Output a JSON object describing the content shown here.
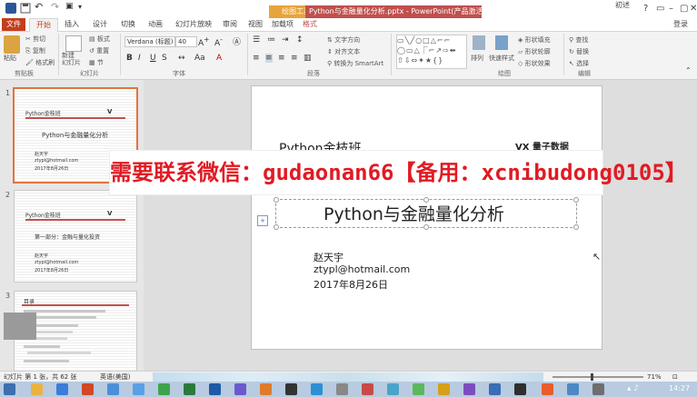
{
  "window": {
    "doc_title": "Python与金融量化分析.pptx - PowerPoint(产品激活失败)",
    "context_tool": "绘图工具",
    "user_label": "登录",
    "top_right_text": "初述"
  },
  "tabs": [
    "文件",
    "开始",
    "插入",
    "设计",
    "切换",
    "动画",
    "幻灯片放映",
    "审阅",
    "视图",
    "加载项",
    "格式"
  ],
  "ribbon": {
    "clipboard": {
      "paste": "粘贴",
      "cut": "剪切",
      "copy": "复制",
      "painter": "格式刷",
      "group": "剪贴板"
    },
    "slides": {
      "new": "新建\n幻灯片",
      "layout": "板式",
      "reset": "重置",
      "section": "节",
      "group": "幻灯片"
    },
    "font": {
      "name": "Verdana (标题)",
      "size": "40",
      "bold": "B",
      "italic": "I",
      "underline": "U",
      "strike": "S",
      "group": "字体"
    },
    "paragraph": {
      "direction": "文字方向",
      "align": "对齐文本",
      "smartart": "转换为 SmartArt",
      "group": "段落"
    },
    "drawing": {
      "arrange": "排列",
      "quick_styles": "快速样式",
      "fill": "形状填充",
      "outline": "形状轮廓",
      "effects": "形状效果",
      "group": "绘图"
    },
    "editing": {
      "find": "查找",
      "replace": "替换",
      "select": "选择",
      "group": "编辑"
    }
  },
  "thumbnails": [
    {
      "number": "1",
      "header": "Python金枝班",
      "title": "Python与金融量化分析",
      "author": "赵天宇",
      "email": "ztypl@hotmail.com",
      "date": "2017年8月26日"
    },
    {
      "number": "2",
      "header": "Python金枝班",
      "title": "第一部分：金融与量化投资",
      "author": "赵天宇",
      "email": "ztypl@hotmail.com",
      "date": "2017年8月26日"
    },
    {
      "number": "3",
      "header": "目录"
    }
  ],
  "slide": {
    "header": "Python金枝班",
    "logo": "VX 量子数据",
    "title": "Python与金融量化分析",
    "author": "赵天宇",
    "email": "ztypl@hotmail.com",
    "date": "2017年8月26日"
  },
  "banner": {
    "text": "需要联系微信：gudaonan66【备用：xcnibudong0105】"
  },
  "status": {
    "slide_info": "幻灯片 第 1 张，共 62 张",
    "lang": "英语(美国)",
    "zoom": "71%",
    "time": "14:27"
  },
  "colors": {
    "accent": "#c43e1c",
    "banner": "#e01b24",
    "title_red": "#c0504d",
    "taskbar": "#b8cbe0"
  }
}
